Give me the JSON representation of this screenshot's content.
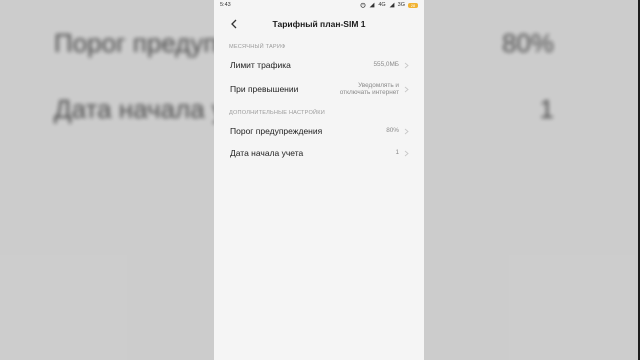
{
  "status_bar": {
    "time": "5:43",
    "network1": "4G",
    "network2": "3G",
    "battery": "28"
  },
  "header": {
    "title": "Тарифный план-SIM 1"
  },
  "sections": {
    "monthly": {
      "header": "МЕСЯЧНЫЙ ТАРИФ",
      "traffic_limit_label": "Лимит трафика",
      "traffic_limit_value": "555,0МБ",
      "on_exceed_label": "При превышении",
      "on_exceed_value_line1": "Уведомлять и",
      "on_exceed_value_line2": "отключать интернет"
    },
    "additional": {
      "header": "ДОПОЛНИТЕЛЬНЫЕ НАСТРОЙКИ",
      "warning_threshold_label": "Порог предупреждения",
      "warning_threshold_value": "80%",
      "billing_start_label": "Дата начала учета",
      "billing_start_value": "1"
    }
  },
  "background_blur": {
    "left_row1": "Порог предупреждения",
    "left_row2": "Дата начала учета",
    "right_row1": "80%",
    "right_row2": "1"
  },
  "colors": {
    "screen_bg": "#f5f5f5",
    "label_text": "#222222",
    "value_text": "#8a8a8a",
    "section_header": "#9b9b9b",
    "battery": "#f1b333"
  },
  "icons": {
    "back": "back-arrow-icon",
    "row_chevron": "chevron-right-icon"
  }
}
